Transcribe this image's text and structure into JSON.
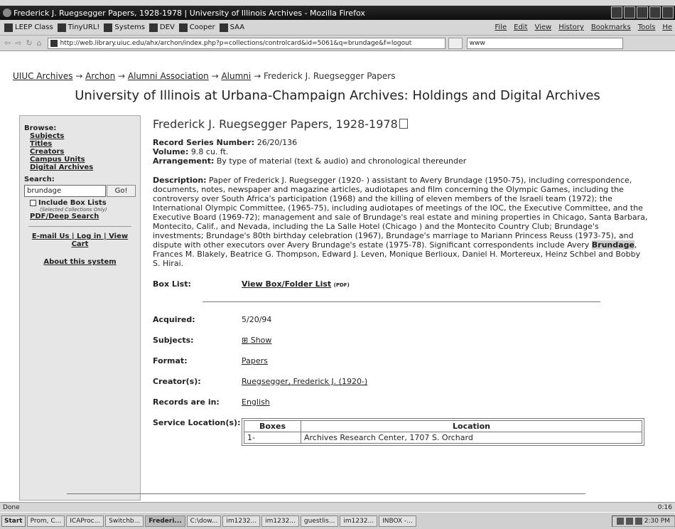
{
  "window": {
    "title": "Frederick J. Ruegsegger Papers, 1928-1978 | University of Illinois Archives - Mozilla Firefox"
  },
  "bookmarks": [
    "LEEP Class",
    "TinyURL!",
    "Systems",
    "DEV",
    "Cooper",
    "SAA"
  ],
  "menu": [
    "File",
    "Edit",
    "View",
    "History",
    "Bookmarks",
    "Tools",
    "He"
  ],
  "url": "http://web.library.uiuc.edu/ahx/archon/index.php?p=collections/controlcard&id=5061&q=brundage&f=logout",
  "search_value": "www",
  "breadcrumb": [
    "UIUC Archives",
    "Archon",
    "Alumni Association",
    "Alumni",
    "Frederick J. Ruegsegger Papers"
  ],
  "site_title": "University of Illinois at Urbana-Champaign Archives: Holdings and Digital Archives",
  "sidebar": {
    "browse": "Browse:",
    "links": [
      "Subjects",
      "Titles",
      "Creators",
      "Campus Units",
      "Digital Archives"
    ],
    "search_label": "Search:",
    "search_value": "brundage",
    "go": "Go!",
    "include_box": "Include Box Lists",
    "selected_note": "(Selected Collections Only)",
    "pdf_search": "PDF/Deep Search",
    "email": "E-mail Us",
    "login": "Log in",
    "view": "View",
    "cart": "Cart",
    "about": "About this system"
  },
  "record": {
    "title": "Frederick J. Ruegsegger Papers, 1928-1978",
    "series_label": "Record Series Number:",
    "series": "26/20/136",
    "volume_label": "Volume:",
    "volume": "9.8 cu. ft.",
    "arr_label": "Arrangement:",
    "arr": "By type of material (text & audio) and chronological thereunder",
    "desc_label": "Description:",
    "desc_a": "Paper of Frederick J. Ruegsegger (1920- ) assistant to Avery Brundage (1950-75), including correspondence, documents, notes, newspaper and magazine articles, audiotapes and film concerning the Olympic Games, including the controversy over South Africa's participation (1968) and the killing of eleven members of the Israeli team (1972); the International Olympic Committee, (1965-75), including audiotapes of meetings of the IOC, the Executive Committee, and the Executive Board (1969-72); management and sale of Brundage's real estate and mining properties in Chicago, Santa Barbara, Montecito, Calif., and Nevada, including the La Salle Hotel (Chicago ) and the Montecito Country Club; Brundage's investments; Brundage's 80th birthday celebration (1967), Brundage's marriage to Mariann Princess Reuss (1973-75), and dispute with other executors over Avery Brundage's estate (1975-78). Significant correspondents include Avery ",
    "desc_hl": "Brundage",
    "desc_b": ", Frances M. Blakely, Beatrice G. Thompson, Edward J. Leven, Monique Berlioux, Daniel H. Mortereux, Heinz Schbel and Bobby S. Hirai.",
    "boxlist_label": "Box List:",
    "boxlist_link": "View Box/Folder List",
    "boxlist_pdf": "(PDF)",
    "acquired_label": "Acquired:",
    "acquired": "5/20/94",
    "subjects_label": "Subjects:",
    "subjects": "⊞ Show",
    "format_label": "Format:",
    "format": "Papers",
    "creator_label": "Creator(s):",
    "creator": "Ruegsegger, Frederick J. (1920-)",
    "lang_label": "Records are in:",
    "lang": "English",
    "service_label": "Service Location(s):",
    "table_headers": [
      "Boxes",
      "Location"
    ],
    "table_rows": [
      [
        "1-",
        "Archives Research Center, 1707 S. Orchard"
      ]
    ]
  },
  "status": {
    "left": "Done",
    "time": "0:16"
  },
  "taskbar": {
    "start": "Start",
    "items": [
      "Prom, C...",
      "ICAProc...",
      "Switchb...",
      "Frederi...",
      "C:\\dow...",
      "im1232...",
      "im1232...",
      "guestlis...",
      "im1232...",
      "INBOX -..."
    ],
    "clock": "2:30 PM"
  }
}
